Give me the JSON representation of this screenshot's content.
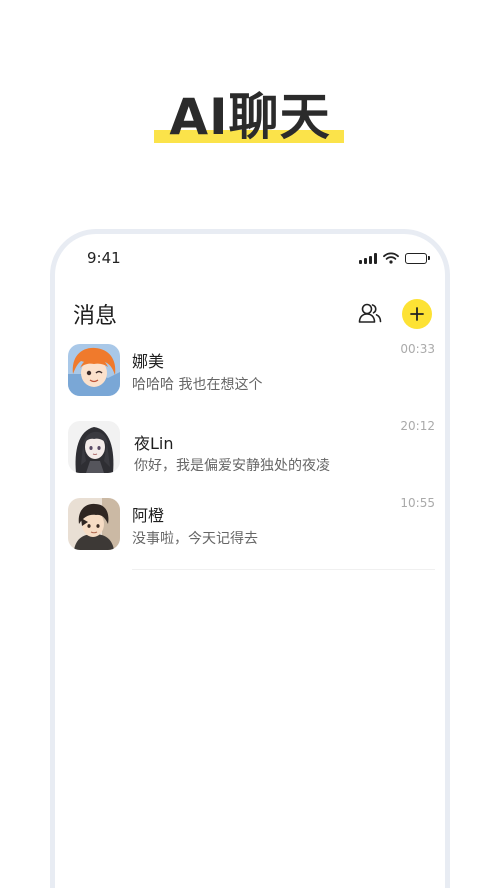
{
  "headline": {
    "title": "AI聊天"
  },
  "status_bar": {
    "time": "9:41"
  },
  "header": {
    "title": "消息"
  },
  "chats": [
    {
      "name": "娜美",
      "preview": "哈哈哈 我也在想这个",
      "time": "00:33"
    },
    {
      "name": "夜Lin",
      "preview": "你好，我是偏爱安静独处的夜凌",
      "time": "20:12"
    },
    {
      "name": "阿橙",
      "preview": "没事啦，今天记得去",
      "time": "10:55"
    }
  ],
  "colors": {
    "accent": "#fde234",
    "highlight": "#fbe34a",
    "frame": "#e8ecf3"
  },
  "icons": [
    "signal-icon",
    "wifi-icon",
    "battery-icon",
    "contacts-icon",
    "plus-icon"
  ]
}
